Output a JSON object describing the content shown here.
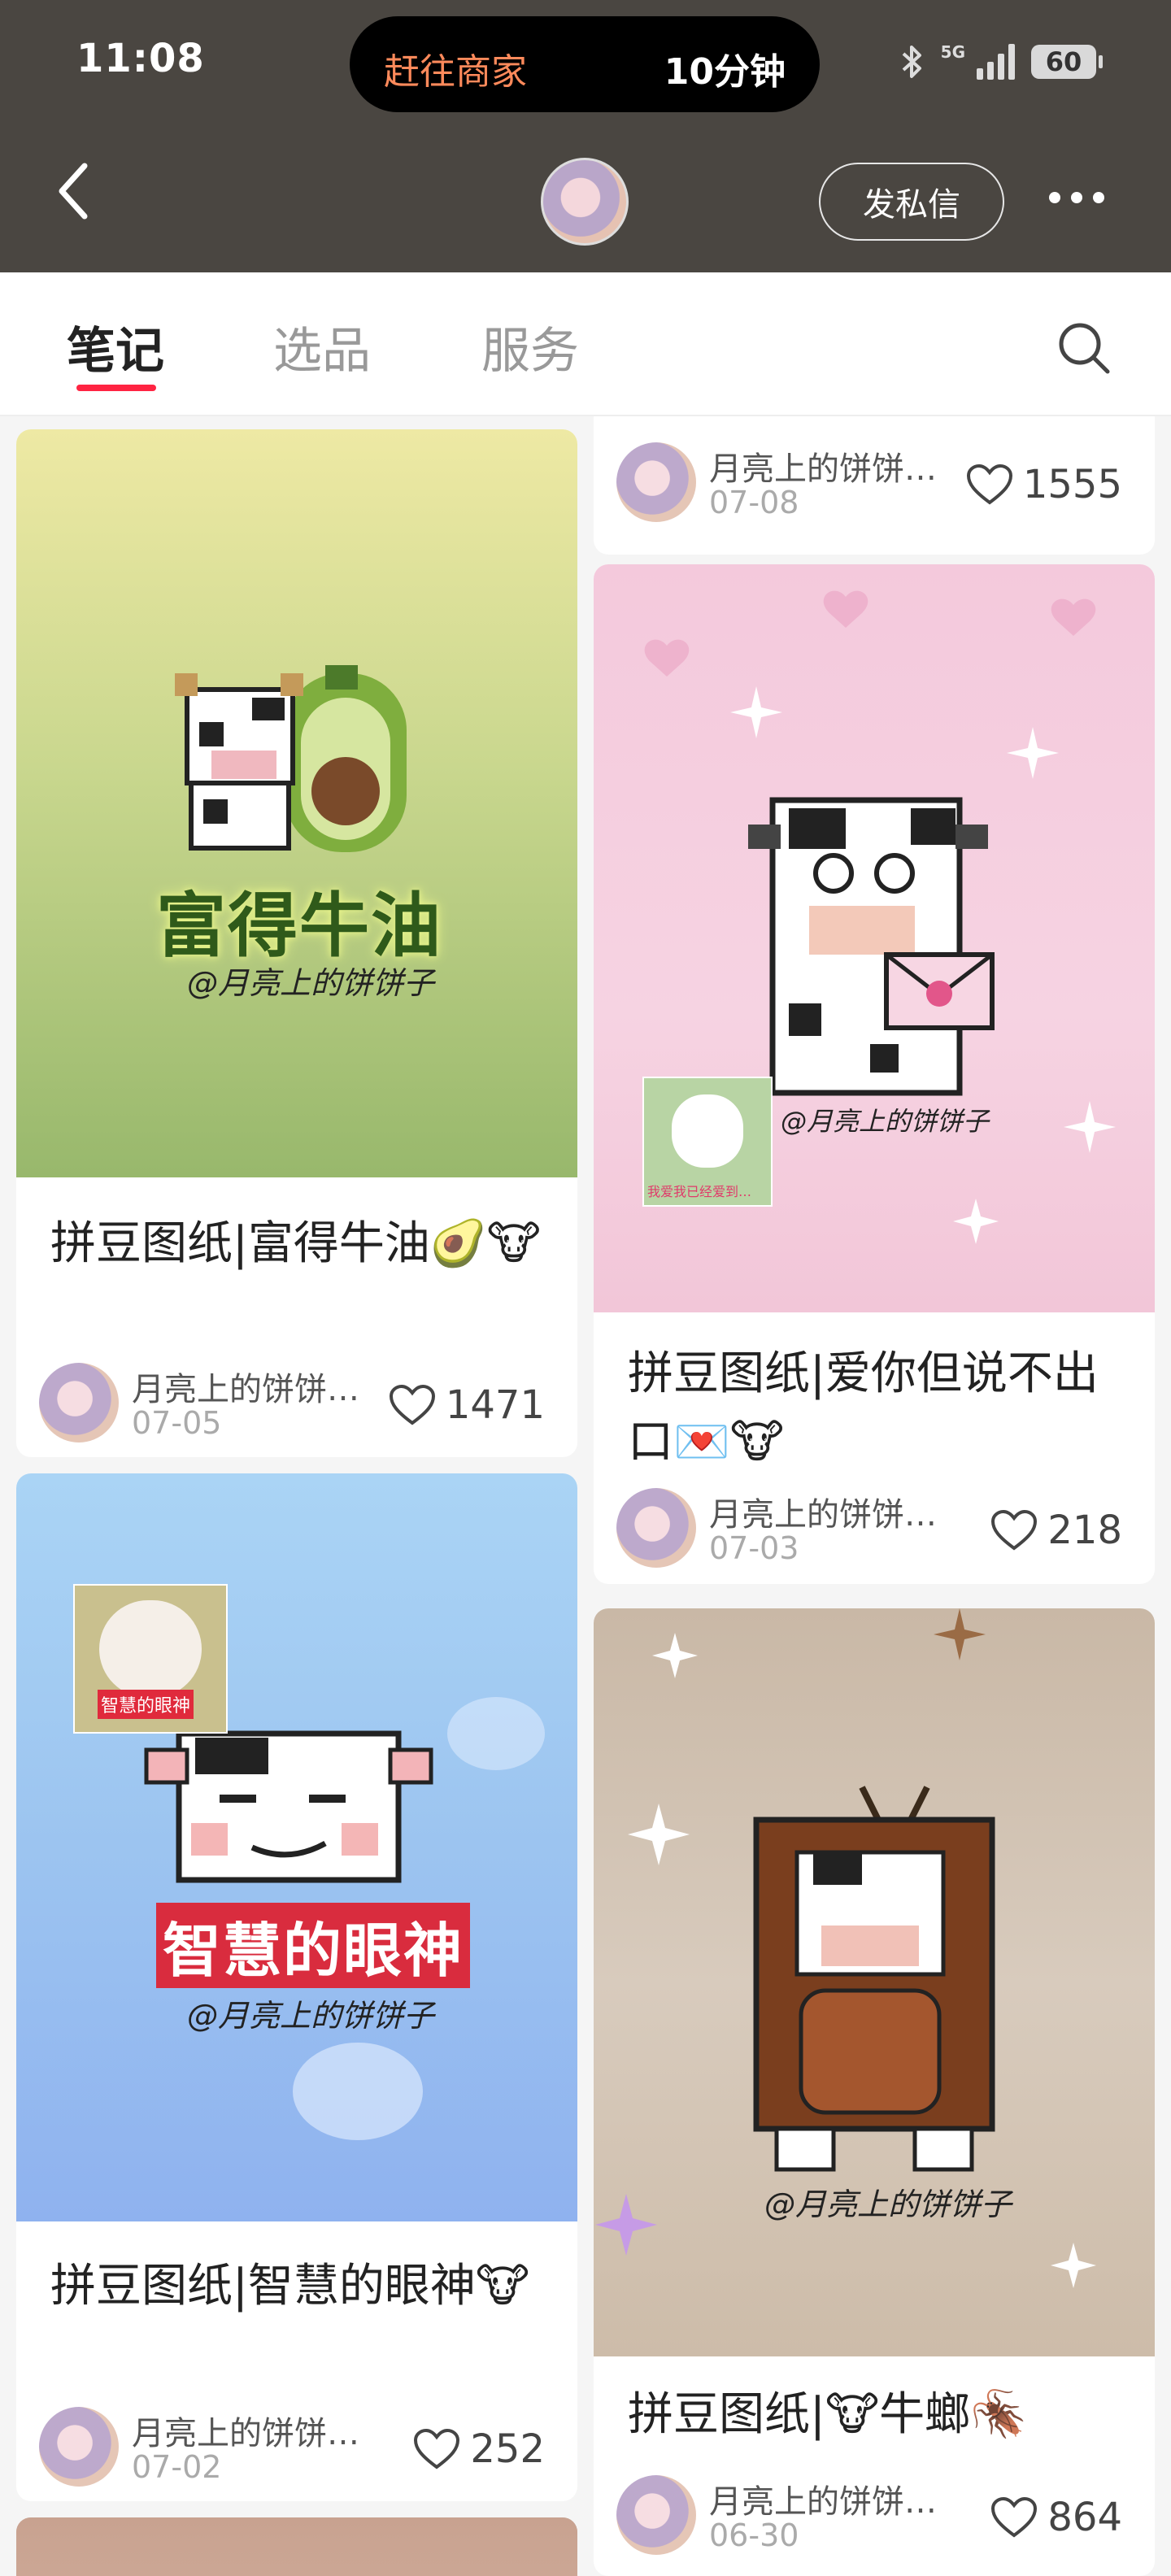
{
  "status": {
    "time": "11:08",
    "island_left": "赶往商家",
    "island_right": "10分钟",
    "network": "5G",
    "battery": "60"
  },
  "header": {
    "dm_label": "发私信"
  },
  "tabs": [
    {
      "label": "笔记"
    },
    {
      "label": "选品"
    },
    {
      "label": "服务"
    }
  ],
  "posts": [
    {
      "title": "",
      "author": "月亮上的饼饼…",
      "date": "07-08",
      "likes": "1555"
    },
    {
      "cover_caption": "富得牛油",
      "watermark": "@月亮上的饼饼子",
      "title": "拼豆图纸|富得牛油🥑🐮",
      "author": "月亮上的饼饼…",
      "date": "07-05",
      "likes": "1471"
    },
    {
      "cover_caption": "",
      "watermark": "@月亮上的饼饼子",
      "inset_caption": "我爱我已经爱到…",
      "title": "拼豆图纸|爱你但说不出口💌🐮",
      "author": "月亮上的饼饼…",
      "date": "07-03",
      "likes": "218"
    },
    {
      "cover_caption": "智慧的眼神",
      "inset_caption": "智慧的眼神",
      "watermark": "@月亮上的饼饼子",
      "title": "拼豆图纸|智慧的眼神🐮",
      "author": "月亮上的饼饼…",
      "date": "07-02",
      "likes": "252"
    },
    {
      "cover_caption": "",
      "watermark": "@月亮上的饼饼子",
      "title": "拼豆图纸|🐮牛螂🪳",
      "author": "月亮上的饼饼…",
      "date": "06-30",
      "likes": "864"
    }
  ],
  "colors": {
    "header_bg": "#4a4641",
    "accent": "#ff2442",
    "island_text": "#ff8a5b"
  }
}
